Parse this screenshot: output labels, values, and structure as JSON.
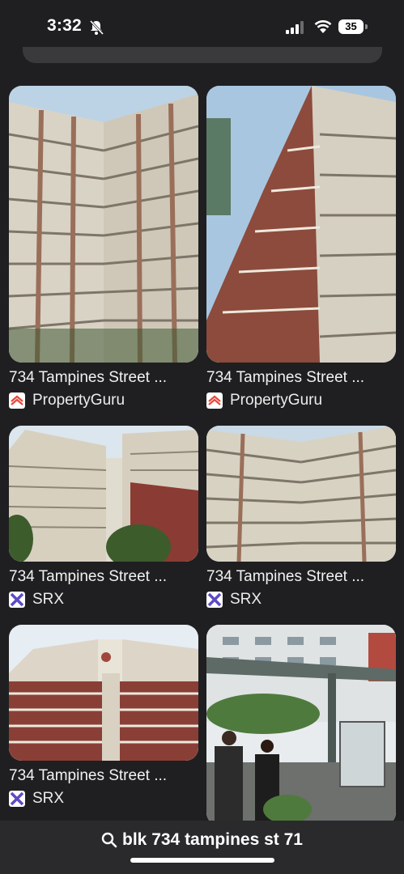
{
  "status": {
    "time": "3:32",
    "battery": "35"
  },
  "results": [
    {
      "title": "734 Tampines Street ...",
      "source": "PropertyGuru",
      "source_icon": "propertyguru-logo-icon",
      "accent": "#e8493b"
    },
    {
      "title": "734 Tampines Street ...",
      "source": "PropertyGuru",
      "source_icon": "propertyguru-logo-icon",
      "accent": "#e8493b"
    },
    {
      "title": "734 Tampines Street ...",
      "source": "SRX",
      "source_icon": "srx-logo-icon",
      "accent": "#5b4bc4"
    },
    {
      "title": "734 Tampines Street ...",
      "source": "SRX",
      "source_icon": "srx-logo-icon",
      "accent": "#5b4bc4"
    },
    {
      "title": "734 Tampines Street ...",
      "source": "SRX",
      "source_icon": "srx-logo-icon",
      "accent": "#5b4bc4"
    }
  ],
  "search": {
    "query": "blk 734 tampines st 71",
    "icon": "search-icon"
  },
  "colors": {
    "background": "#1f1f21",
    "search_bar": "#2a2a2c"
  }
}
